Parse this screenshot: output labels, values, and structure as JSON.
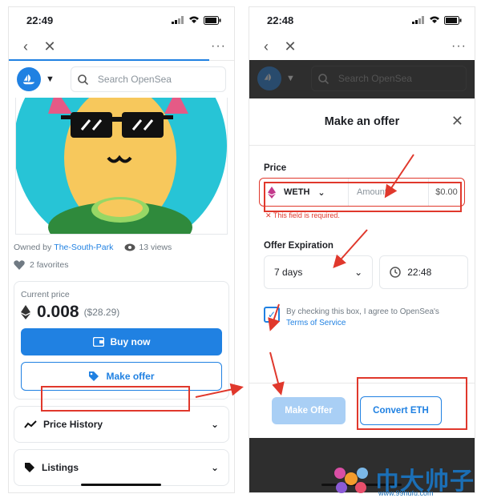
{
  "left": {
    "time": "22:49",
    "search_placeholder": "Search OpenSea",
    "owned_by_prefix": "Owned by",
    "owner_name": "The-South-Park",
    "views": "13 views",
    "favorites": "2 favorites",
    "current_price_label": "Current price",
    "price_eth": "0.008",
    "price_usd": "($28.29)",
    "buy_now": "Buy now",
    "make_offer": "Make offer",
    "price_history": "Price History",
    "listings": "Listings"
  },
  "right": {
    "time": "22:48",
    "search_placeholder": "Search OpenSea",
    "modal_title": "Make an offer",
    "price_label": "Price",
    "currency": "WETH",
    "amount_placeholder": "Amount",
    "usd_value": "$0.00",
    "error_text": "This field is required.",
    "expiration_label": "Offer Expiration",
    "expiration_value": "7 days",
    "time_value": "22:48",
    "agree_text": "By checking this box, I agree to OpenSea's",
    "terms_link": "Terms of Service",
    "checkbox_checked": true,
    "make_offer_button": "Make Offer",
    "convert_button": "Convert ETH"
  },
  "watermark": {
    "text": "巾大帅子",
    "url": "www.99hufu.com"
  },
  "colors": {
    "accent": "#2081e2",
    "annotation_red": "#e0382c",
    "hero_bg": "#27c4d6"
  },
  "icons": [
    "back-icon",
    "close-icon",
    "more-icon",
    "opensea-logo-icon",
    "chevron-down-icon",
    "search-icon",
    "eye-icon",
    "heart-icon",
    "eth-icon",
    "wallet-icon",
    "tag-icon",
    "chart-line-icon",
    "list-icon",
    "clock-icon",
    "check-icon"
  ]
}
